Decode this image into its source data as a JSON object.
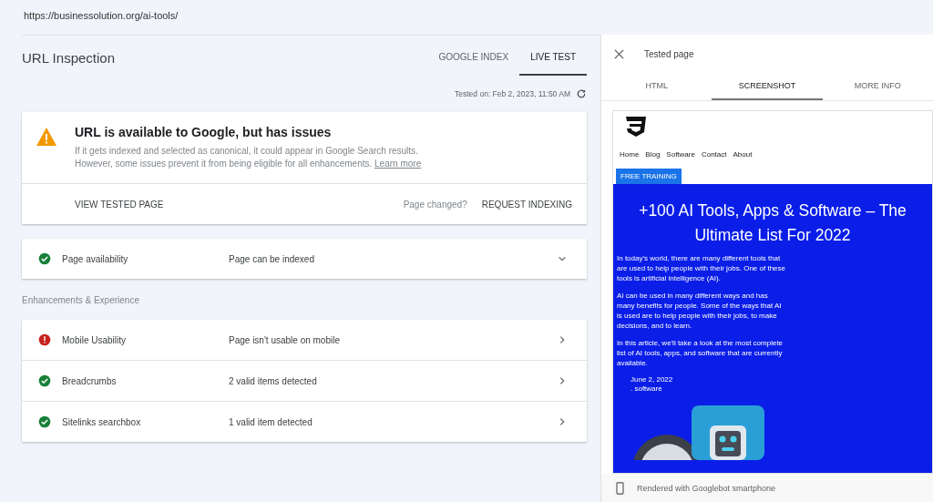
{
  "url_bar": {
    "url": "https://businessolution.org/ai-tools/"
  },
  "inspection": {
    "title": "URL Inspection",
    "tabs": [
      {
        "label": "GOOGLE INDEX",
        "selected": false
      },
      {
        "label": "LIVE TEST",
        "selected": true
      }
    ],
    "tested_on": "Tested on: Feb 2, 2023, 11:50 AM",
    "status_card": {
      "title": "URL is available to Google, but has issues",
      "text": "If it gets indexed and selected as canonical, it could appear in Google Search results. However, some issues prevent it from being eligible for all enhancements.",
      "link": "Learn more",
      "view_button": "VIEW TESTED PAGE",
      "changed_label": "Page changed?",
      "request_button": "REQUEST INDEXING"
    },
    "availability": {
      "kind": "valid",
      "name": "Page availability",
      "result": "Page can be indexed",
      "expanded": false
    },
    "section_label": "Enhancements & Experience",
    "enhancements": [
      {
        "kind": "error",
        "name": "Mobile Usability",
        "result": "Page isn't usable on mobile"
      },
      {
        "kind": "valid",
        "name": "Breadcrumbs",
        "result": "2 valid items detected"
      },
      {
        "kind": "valid",
        "name": "Sitelinks searchbox",
        "result": "1 valid item detected"
      }
    ]
  },
  "tested_page": {
    "title": "Tested page",
    "tabs": [
      {
        "label": "HTML",
        "selected": false
      },
      {
        "label": "SCREENSHOT",
        "selected": true
      },
      {
        "label": "MORE INFO",
        "selected": false
      }
    ],
    "preview": {
      "nav": [
        "Home",
        "Blog",
        "Software",
        "Contact",
        "About"
      ],
      "button": "FREE TRAINING",
      "headline": "+100 AI Tools, Apps & Software – The Ultimate List For 2022",
      "paragraphs": [
        "In today's world, there are many different tools that are used to help people with their jobs. One of these tools is artificial intelligence (AI).",
        "AI can be used in many different ways and has many benefits for people. Some of the ways that AI is used are to help people with their jobs, to make decisions, and to learn.",
        "In this article, we'll take a look at the most complete list of AI tools, apps, and software that are currently available."
      ],
      "date": "June 2, 2022",
      "category": ". software"
    },
    "footer": "Rendered with Googlebot smartphone"
  }
}
